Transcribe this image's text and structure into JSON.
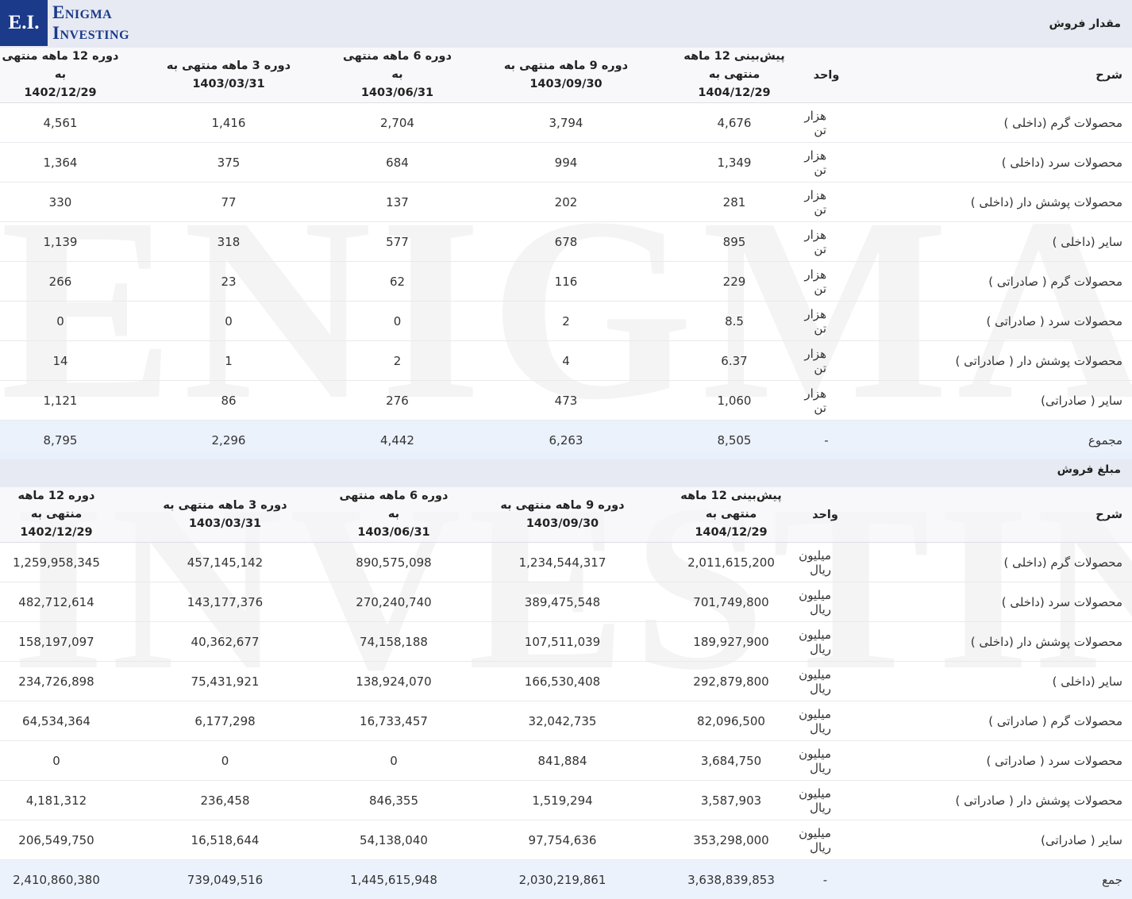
{
  "logo": {
    "mark": "E.I.",
    "line1": "Enigma",
    "line2": "Investing"
  },
  "watermark": {
    "line1": "ENIGMA",
    "line2": "INVESTING"
  },
  "sections": [
    {
      "title": "مقدار فروش",
      "headers": {
        "desc": "شرح",
        "unit": "واحد",
        "periods": [
          {
            "line1": "پیش‌بینی 12 ماهه منتهی به",
            "line2": "1404/12/29"
          },
          {
            "line1": "دوره 9 ماهه منتهی به",
            "line2": "1403/09/30"
          },
          {
            "line1": "دوره 6 ماهه منتهی به",
            "line2": "1403/06/31"
          },
          {
            "line1": "دوره 3 ماهه منتهی به",
            "line2": "1403/03/31"
          },
          {
            "line1": "دوره 12 ماهه منتهی به",
            "line2": "1402/12/29"
          }
        ]
      },
      "rows": [
        {
          "desc": "محصولات گرم (داخلی )",
          "unit": "هزار تن",
          "values": [
            "4,676",
            "3,794",
            "2,704",
            "1,416",
            "4,561"
          ]
        },
        {
          "desc": "محصولات سرد (داخلی )",
          "unit": "هزار تن",
          "values": [
            "1,349",
            "994",
            "684",
            "375",
            "1,364"
          ]
        },
        {
          "desc": "محصولات پوشش دار (داخلی )",
          "unit": "هزار تن",
          "values": [
            "281",
            "202",
            "137",
            "77",
            "330"
          ]
        },
        {
          "desc": "سایر (داخلی )",
          "unit": "هزار تن",
          "values": [
            "895",
            "678",
            "577",
            "318",
            "1,139"
          ]
        },
        {
          "desc": "محصولات گرم ( صادراتی )",
          "unit": "هزار تن",
          "values": [
            "229",
            "116",
            "62",
            "23",
            "266"
          ]
        },
        {
          "desc": "محصولات سرد ( صادراتی )",
          "unit": "هزار تن",
          "values": [
            "8.5",
            "2",
            "0",
            "0",
            "0"
          ]
        },
        {
          "desc": "محصولات پوشش دار ( صادراتی )",
          "unit": "هزار تن",
          "values": [
            "6.37",
            "4",
            "2",
            "1",
            "14"
          ]
        },
        {
          "desc": "سایر ( صادراتی)",
          "unit": "هزار تن",
          "values": [
            "1,060",
            "473",
            "276",
            "86",
            "1,121"
          ]
        }
      ],
      "total": {
        "desc": "مجموع",
        "unit": "-",
        "values": [
          "8,505",
          "6,263",
          "4,442",
          "2,296",
          "8,795"
        ]
      }
    },
    {
      "title": "مبلغ فروش",
      "headers": {
        "desc": "شرح",
        "unit": "واحد",
        "periods": [
          {
            "line1": "پیش‌بینی 12 ماهه منتهی به",
            "line2": "1404/12/29"
          },
          {
            "line1": "دوره 9 ماهه منتهی به",
            "line2": "1403/09/30"
          },
          {
            "line1": "دوره 6 ماهه منتهی به",
            "line2": "1403/06/31"
          },
          {
            "line1": "دوره 3 ماهه منتهی به",
            "line2": "1403/03/31"
          },
          {
            "line1": "دوره 12 ماهه منتهی به",
            "line2": "1402/12/29"
          }
        ]
      },
      "rows": [
        {
          "desc": "محصولات گرم (داخلی )",
          "unit": "میلیون ریال",
          "values": [
            "2,011,615,200",
            "1,234,544,317",
            "890,575,098",
            "457,145,142",
            "1,259,958,345"
          ]
        },
        {
          "desc": "محصولات سرد (داخلی )",
          "unit": "میلیون ریال",
          "values": [
            "701,749,800",
            "389,475,548",
            "270,240,740",
            "143,177,376",
            "482,712,614"
          ]
        },
        {
          "desc": "محصولات پوشش دار (داخلی )",
          "unit": "میلیون ریال",
          "values": [
            "189,927,900",
            "107,511,039",
            "74,158,188",
            "40,362,677",
            "158,197,097"
          ]
        },
        {
          "desc": "سایر (داخلی )",
          "unit": "میلیون ریال",
          "values": [
            "292,879,800",
            "166,530,408",
            "138,924,070",
            "75,431,921",
            "234,726,898"
          ]
        },
        {
          "desc": "محصولات گرم ( صادراتی )",
          "unit": "میلیون ریال",
          "values": [
            "82,096,500",
            "32,042,735",
            "16,733,457",
            "6,177,298",
            "64,534,364"
          ]
        },
        {
          "desc": "محصولات سرد ( صادراتی )",
          "unit": "میلیون ریال",
          "values": [
            "3,684,750",
            "841,884",
            "0",
            "0",
            "0"
          ]
        },
        {
          "desc": "محصولات پوشش دار ( صادراتی )",
          "unit": "میلیون ریال",
          "values": [
            "3,587,903",
            "1,519,294",
            "846,355",
            "236,458",
            "4,181,312"
          ]
        },
        {
          "desc": "سایر ( صادراتی)",
          "unit": "میلیون ریال",
          "values": [
            "353,298,000",
            "97,754,636",
            "54,138,040",
            "16,518,644",
            "206,549,750"
          ]
        }
      ],
      "total": {
        "desc": "جمع",
        "unit": "-",
        "values": [
          "3,638,839,853",
          "2,030,219,861",
          "1,445,615,948",
          "739,049,516",
          "2,410,860,380"
        ]
      }
    }
  ]
}
